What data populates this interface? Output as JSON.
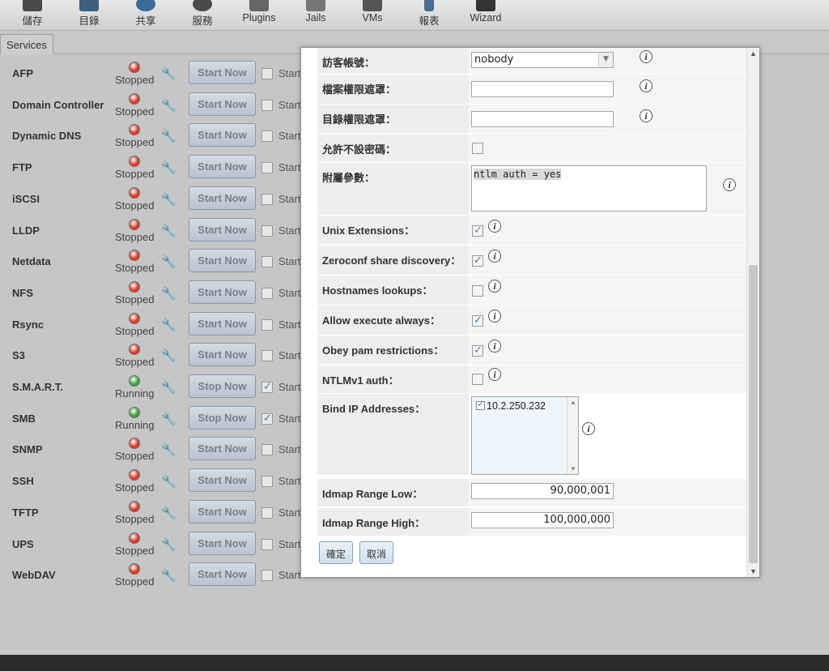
{
  "toolbar": {
    "items": [
      {
        "label": "儲存",
        "icon": "storage-icon"
      },
      {
        "label": "目錄",
        "icon": "directory-icon"
      },
      {
        "label": "共享",
        "icon": "sharing-icon"
      },
      {
        "label": "服務",
        "icon": "services-gear-icon"
      },
      {
        "label": "Plugins",
        "icon": "plugins-icon"
      },
      {
        "label": "Jails",
        "icon": "jails-icon"
      },
      {
        "label": "VMs",
        "icon": "vms-icon"
      },
      {
        "label": "報表",
        "icon": "reporting-icon"
      },
      {
        "label": "Wizard",
        "icon": "wizard-icon"
      }
    ]
  },
  "tab": {
    "label": "Services"
  },
  "services": [
    {
      "name": "AFP",
      "status": "Stopped",
      "button": "Start Now",
      "checked": false,
      "start_label": "Start"
    },
    {
      "name": "Domain Controller",
      "status": "Stopped",
      "button": "Start Now",
      "checked": false,
      "start_label": "Start"
    },
    {
      "name": "Dynamic DNS",
      "status": "Stopped",
      "button": "Start Now",
      "checked": false,
      "start_label": "Start"
    },
    {
      "name": "FTP",
      "status": "Stopped",
      "button": "Start Now",
      "checked": false,
      "start_label": "Start"
    },
    {
      "name": "iSCSI",
      "status": "Stopped",
      "button": "Start Now",
      "checked": false,
      "start_label": "Start"
    },
    {
      "name": "LLDP",
      "status": "Stopped",
      "button": "Start Now",
      "checked": false,
      "start_label": "Start"
    },
    {
      "name": "Netdata",
      "status": "Stopped",
      "button": "Start Now",
      "checked": false,
      "start_label": "Start"
    },
    {
      "name": "NFS",
      "status": "Stopped",
      "button": "Start Now",
      "checked": false,
      "start_label": "Start"
    },
    {
      "name": "Rsync",
      "status": "Stopped",
      "button": "Start Now",
      "checked": false,
      "start_label": "Start"
    },
    {
      "name": "S3",
      "status": "Stopped",
      "button": "Start Now",
      "checked": false,
      "start_label": "Start"
    },
    {
      "name": "S.M.A.R.T.",
      "status": "Running",
      "button": "Stop Now",
      "checked": true,
      "start_label": "Start"
    },
    {
      "name": "SMB",
      "status": "Running",
      "button": "Stop Now",
      "checked": true,
      "start_label": "Start"
    },
    {
      "name": "SNMP",
      "status": "Stopped",
      "button": "Start Now",
      "checked": false,
      "start_label": "Start"
    },
    {
      "name": "SSH",
      "status": "Stopped",
      "button": "Start Now",
      "checked": false,
      "start_label": "Start"
    },
    {
      "name": "TFTP",
      "status": "Stopped",
      "button": "Start Now",
      "checked": false,
      "start_label": "Start"
    },
    {
      "name": "UPS",
      "status": "Stopped",
      "button": "Start Now",
      "checked": false,
      "start_label": "Start"
    },
    {
      "name": "WebDAV",
      "status": "Stopped",
      "button": "Start Now",
      "checked": false,
      "start_label": "Start"
    }
  ],
  "status_colors": {
    "Stopped": "#d93a2b",
    "Running": "#3aa33a"
  },
  "dialog": {
    "guest_account": {
      "label": "訪客帳號：",
      "value": "nobody"
    },
    "file_mask": {
      "label": "檔案權限遮罩：",
      "value": ""
    },
    "dir_mask": {
      "label": "目錄權限遮罩：",
      "value": ""
    },
    "allow_empty_password": {
      "label": "允許不設密碼：",
      "checked": false
    },
    "aux_params": {
      "label": "附屬參數：",
      "value": "ntlm auth = yes"
    },
    "unix_extensions": {
      "label": "Unix Extensions：",
      "checked": true
    },
    "zeroconf": {
      "label": "Zeroconf share discovery：",
      "checked": true
    },
    "hostnames_lookups": {
      "label": "Hostnames lookups：",
      "checked": false
    },
    "allow_execute_always": {
      "label": "Allow execute always：",
      "checked": true
    },
    "obey_pam": {
      "label": "Obey pam restrictions：",
      "checked": true
    },
    "ntlmv1": {
      "label": "NTLMv1 auth：",
      "checked": false
    },
    "bind_ip": {
      "label": "Bind IP Addresses：",
      "items": [
        {
          "value": "10.2.250.232",
          "checked": true
        }
      ]
    },
    "idmap_low": {
      "label": "Idmap Range Low：",
      "value": "90,000,001"
    },
    "idmap_high": {
      "label": "Idmap Range High：",
      "value": "100,000,000"
    },
    "ok_button": "確定",
    "cancel_button": "取消"
  }
}
